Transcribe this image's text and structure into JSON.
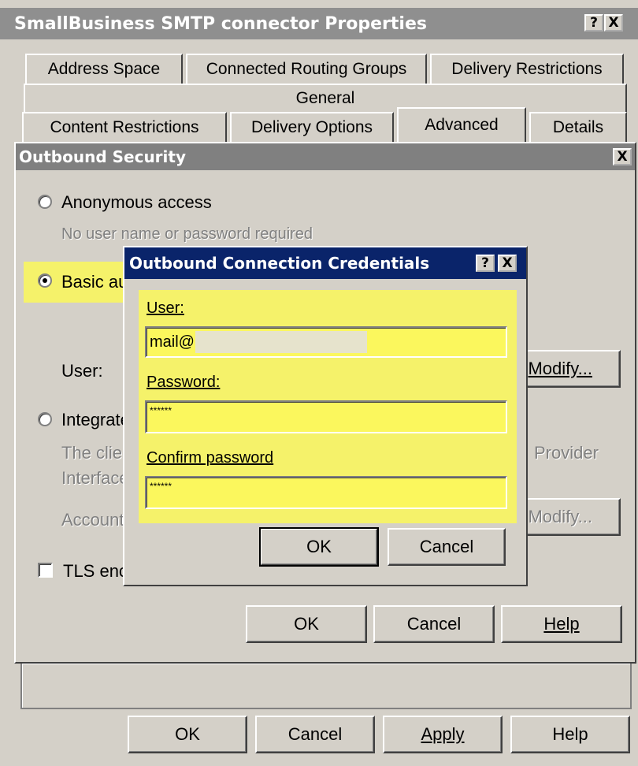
{
  "outer": {
    "title": "SmallBusiness SMTP connector Properties",
    "help_btn": "?",
    "close_btn": "X",
    "tabs_row1": [
      "Address Space",
      "Connected Routing Groups",
      "Delivery Restrictions"
    ],
    "tabs_row2": [
      "General"
    ],
    "tabs_row3": [
      "Content Restrictions",
      "Delivery Options",
      "Advanced",
      "Details"
    ],
    "buttons": {
      "ok": "OK",
      "cancel": "Cancel",
      "apply": "Apply",
      "help": "Help"
    }
  },
  "security": {
    "title": "Outbound Security",
    "close_btn": "X",
    "anonymous_label": "Anonymous access",
    "anonymous_desc": "No user name or password required",
    "basic_label": "Basic au",
    "user_label": "User:",
    "modify_label": "Modify...",
    "integrated_label": "Integrate",
    "integrated_desc1": "The clie",
    "integrated_desc1_right": "Provider",
    "integrated_desc2": "Interface",
    "account_label": "Account",
    "modify2_label": "Modify...",
    "tls_label": "TLS enc",
    "buttons": {
      "ok": "OK",
      "cancel": "Cancel",
      "help": "Help"
    }
  },
  "credentials": {
    "title": "Outbound Connection Credentials",
    "help_btn": "?",
    "close_btn": "X",
    "user_label": "User:",
    "user_value": "mail@",
    "password_label": "Password:",
    "password_value": "******",
    "confirm_label": "Confirm password",
    "confirm_value": "******",
    "buttons": {
      "ok": "OK",
      "cancel": "Cancel"
    }
  },
  "colors": {
    "highlight": "#f5f26a",
    "titlebar_active": "#0a246a",
    "titlebar_inactive": "#808080",
    "face": "#d4d0c8"
  }
}
